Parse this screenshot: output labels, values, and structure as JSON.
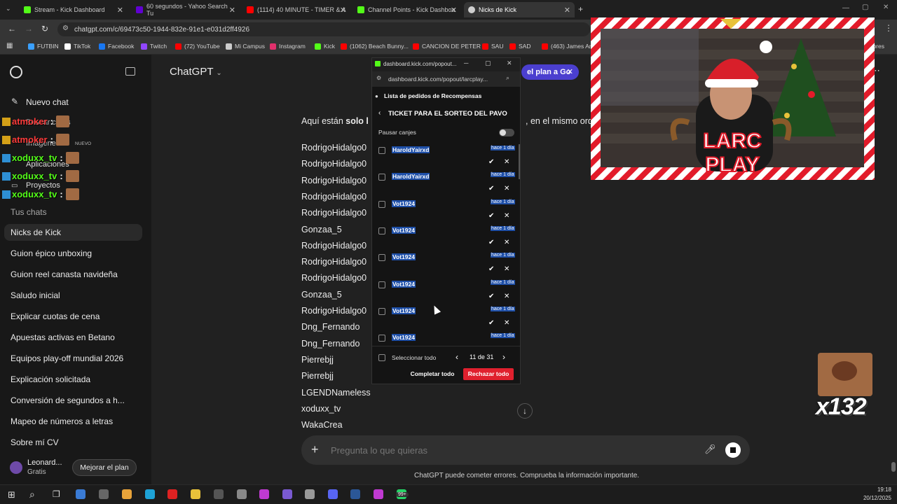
{
  "tabs": [
    {
      "label": "Stream - Kick Dashboard",
      "color": "#53fc18"
    },
    {
      "label": "60 segundos - Yahoo Search Tu",
      "color": "#6001d2"
    },
    {
      "label": "(1114) 40 MINUTE - TIMER & A",
      "color": "#ff0000"
    },
    {
      "label": "Channel Points - Kick Dashboa",
      "color": "#53fc18"
    },
    {
      "label": "Nicks de Kick",
      "color": "#cfcfcf"
    }
  ],
  "address": "chatgpt.com/c/69473c50-1944-832e-91e1-e031d2ff4926",
  "bookmarks": [
    {
      "label": "FUTBIN",
      "color": "#3aa0ff"
    },
    {
      "label": "TikTok",
      "color": "#ffffff"
    },
    {
      "label": "Facebook",
      "color": "#1877f2"
    },
    {
      "label": "Twitch",
      "color": "#9146ff"
    },
    {
      "label": "(72) YouTube",
      "color": "#ff0000"
    },
    {
      "label": "Mi Campus",
      "color": "#cccccc"
    },
    {
      "label": "Instagram",
      "color": "#e1306c"
    },
    {
      "label": "Kick",
      "color": "#53fc18"
    },
    {
      "label": "(1062) Beach Bunny...",
      "color": "#ff0000"
    },
    {
      "label": "CANCION DE PETER",
      "color": "#ff0000"
    },
    {
      "label": "SAU",
      "color": "#ff0000"
    },
    {
      "label": "SAD",
      "color": "#ff0000"
    },
    {
      "label": "(463) James Arthu",
      "color": "#ff0000"
    },
    {
      "label": "adores",
      "color": "#cccccc"
    }
  ],
  "sidebar": {
    "new_chat": "Nuevo chat",
    "search": "Buscar chats",
    "images": "Imágenes",
    "images_badge": "NUEVO",
    "apps": "Aplicaciones",
    "projects": "Proyectos",
    "section": "Tus chats",
    "chats": [
      "Nicks de Kick",
      "Guion épico unboxing",
      "Guion reel canasta navideña",
      "Saludo inicial",
      "Explicar cuotas de cena",
      "Apuestas activas en Betano",
      "Equipos play-off mundial 2026",
      "Explicación solicitada",
      "Conversión de segundos a h...",
      "Mapeo de números a letras",
      "Sobre mí CV"
    ],
    "user_name": "Leonard...",
    "user_plan": "Gratis",
    "upgrade": "Mejorar el plan"
  },
  "overlay_chat": [
    {
      "user": "atmoker",
      "sep": ":",
      "color": "#ff3b3b"
    },
    {
      "user": "atmoker",
      "sep": ":",
      "color": "#ff3b3b"
    },
    {
      "user": "xoduxx_tv",
      "sep": ":",
      "color": "#53fc18"
    },
    {
      "user": "xoduxx_tv",
      "sep": ":",
      "color": "#53fc18"
    },
    {
      "user": "xoduxx_tv",
      "sep": ":",
      "color": "#53fc18"
    }
  ],
  "main": {
    "title": "ChatGPT",
    "plan_button": "el plan a Go",
    "intro_pre": "Aquí están ",
    "intro_bold": "solo l",
    "intro_post": ", en el mismo orde",
    "nicks": [
      "RodrigoHidalgo0",
      "RodrigoHidalgo0",
      "RodrigoHidalgo0",
      "RodrigoHidalgo0",
      "RodrigoHidalgo0",
      "Gonzaa_5",
      "RodrigoHidalgo0",
      "RodrigoHidalgo0",
      "RodrigoHidalgo0",
      "Gonzaa_5",
      "RodrigoHidalgo0",
      "Dng_Fernando",
      "Dng_Fernando",
      "Pierrebjj",
      "Pierrebjj",
      "LGENDNameless",
      "xoduxx_tv",
      "WakaCrea"
    ],
    "composer_placeholder": "Pregunta lo que quieras",
    "disclaimer": "ChatGPT puede cometer errores. Comprueba la información importante."
  },
  "popup": {
    "window_title": "dashboard.kick.com/popout...",
    "url": "dashboard.kick.com/popout/larcplay...",
    "header": "Lista de pedidos de Recompensas",
    "reward_title": "TICKET PARA EL SORTEO DEL PAVO",
    "pause_label": "Pausar canjes",
    "rows": [
      {
        "user": "HaroldYairxd",
        "time": "hace 1 día"
      },
      {
        "user": "HaroldYairxd",
        "time": "hace 1 día"
      },
      {
        "user": "Vot1924",
        "time": "hace 1 día"
      },
      {
        "user": "Vot1924",
        "time": "hace 1 día"
      },
      {
        "user": "Vot1924",
        "time": "hace 1 día"
      },
      {
        "user": "Vot1924",
        "time": "hace 1 día"
      },
      {
        "user": "Vot1924",
        "time": "hace 1 día"
      },
      {
        "user": "Vot1924",
        "time": "hace 1 día"
      }
    ],
    "select_all": "Seleccionar todo",
    "pagination": "11 de 31",
    "complete_all": "Completar todo",
    "reject_all": "Rechazar todo"
  },
  "stream": {
    "logo_line1": "LARC",
    "logo_line2": "PLAY",
    "counter": "x132"
  },
  "taskbar": {
    "time": "19:18",
    "date": "20/12/2025",
    "badge": "99+"
  }
}
